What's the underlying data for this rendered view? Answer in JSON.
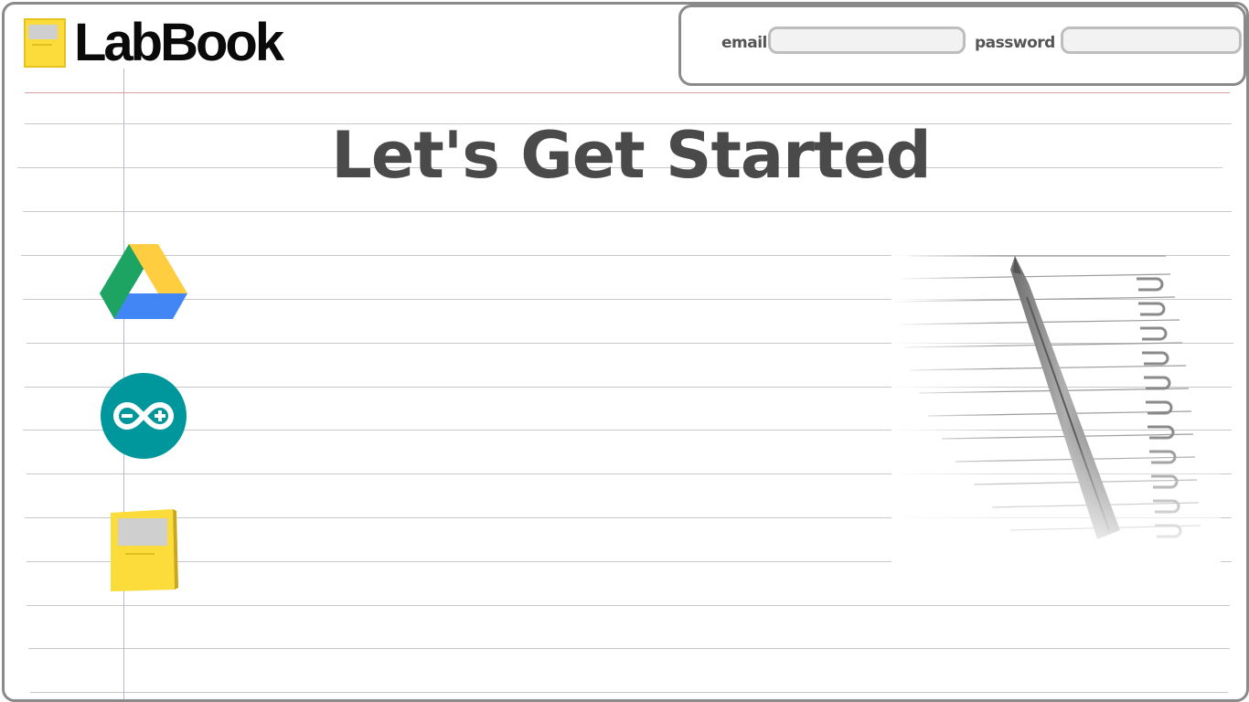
{
  "app": {
    "name": "LabBook"
  },
  "login": {
    "email_label": "email",
    "email_value": "",
    "password_label": "password",
    "password_value": ""
  },
  "main": {
    "title": "Let's Get Started"
  },
  "apps": [
    {
      "name": "google-drive-icon"
    },
    {
      "name": "arduino-icon"
    },
    {
      "name": "labbook-notebook-icon"
    }
  ],
  "colors": {
    "drive_green": "#1da462",
    "drive_yellow": "#ffcd40",
    "drive_blue": "#4285f4",
    "arduino_teal": "#00979c",
    "notebook_yellow": "#fcdc3b",
    "title_gray": "#4a4a4a"
  }
}
